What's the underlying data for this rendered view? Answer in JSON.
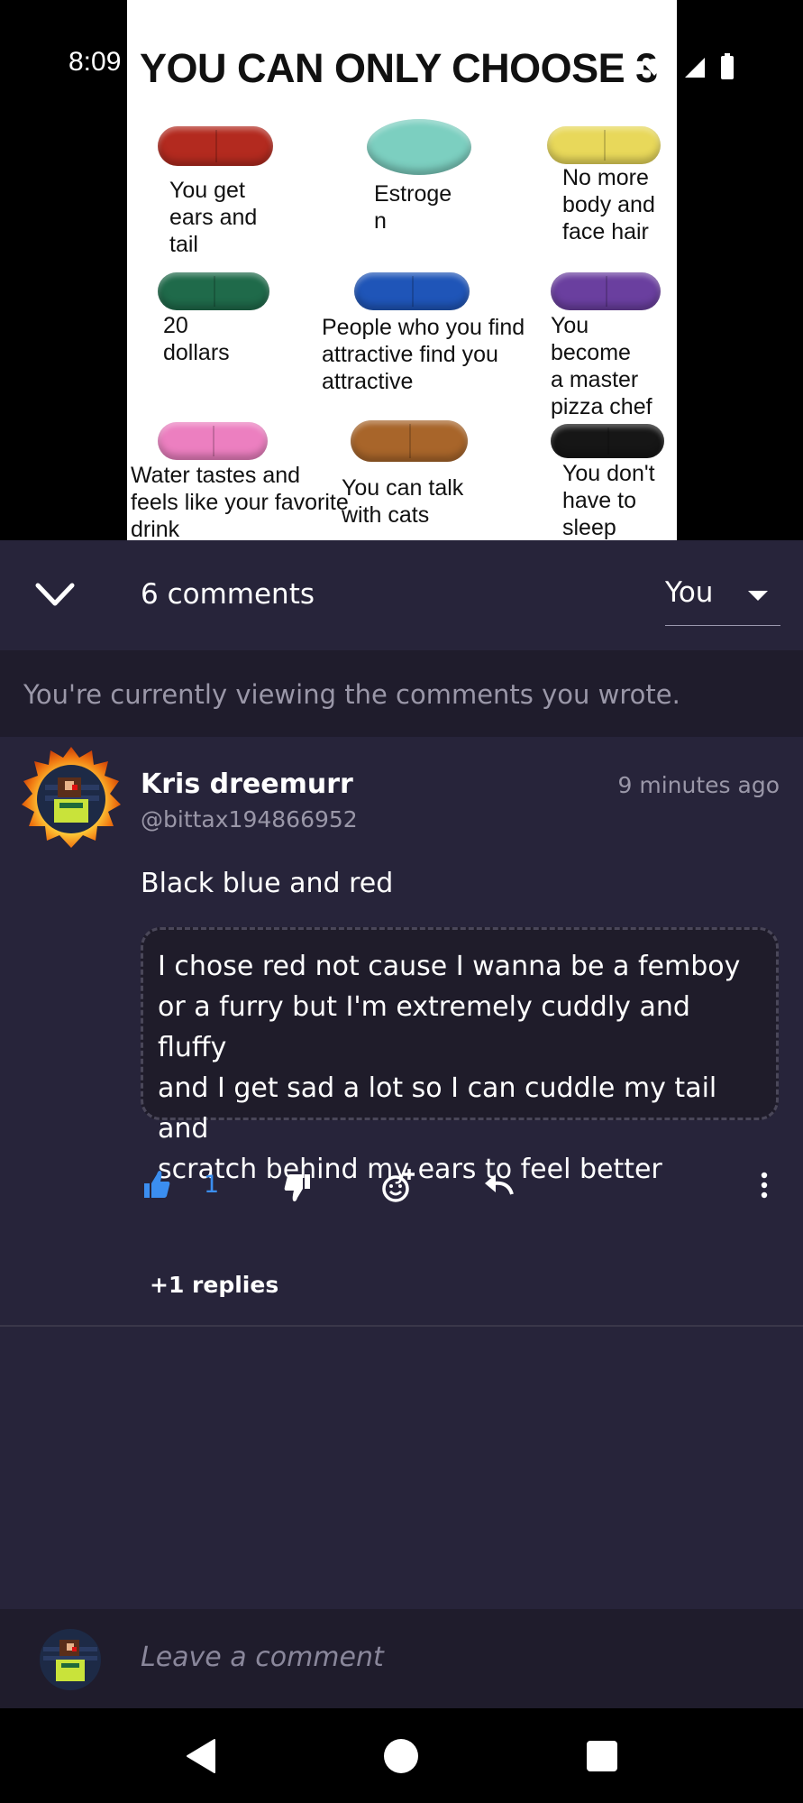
{
  "status_bar": {
    "time": "8:09"
  },
  "meme": {
    "title": "YOU CAN ONLY CHOOSE 3",
    "pills": [
      {
        "label": "You get\nears and\ntail",
        "color": "#b32a1f"
      },
      {
        "label": "Estroge\nn",
        "color": "#7ccfc0"
      },
      {
        "label": "No more\nbody and\nface hair",
        "color": "#e8d85a"
      },
      {
        "label": "20\ndollars",
        "color": "#1f6a4a"
      },
      {
        "label": "People who you find\nattractive find you\nattractive",
        "color": "#1f55b8"
      },
      {
        "label": "You\nbecome\na master\npizza chef",
        "color": "#6a3f9f"
      },
      {
        "label": "Water tastes and\nfeels like your favorite\ndrink",
        "color": "#ec7fc0"
      },
      {
        "label": "You can talk\nwith cats",
        "color": "#a8652a"
      },
      {
        "label": "You don't\nhave to\nsleep",
        "color": "#161616"
      }
    ]
  },
  "comments": {
    "count_label": "6 comments",
    "filter_value": "You",
    "notice": "You're currently viewing the comments you wrote.",
    "items": [
      {
        "author": "Kris dreemurr",
        "handle": "@bittax194866952",
        "time": "9 minutes ago",
        "text": "Black blue and red",
        "quote_lines": [
          "I chose red not cause I wanna be a femboy",
          "or a furry but I'm extremely cuddly and fluffy",
          "and I get sad a lot so I can cuddle my tail and",
          "scratch behind my ears to feel better"
        ],
        "likes": "1",
        "replies_label": "+1 replies"
      }
    ]
  },
  "compose": {
    "placeholder": "Leave a comment"
  },
  "colors": {
    "background": "#27243a",
    "accent": "#3b8ef0",
    "muted": "#9a97a8"
  }
}
